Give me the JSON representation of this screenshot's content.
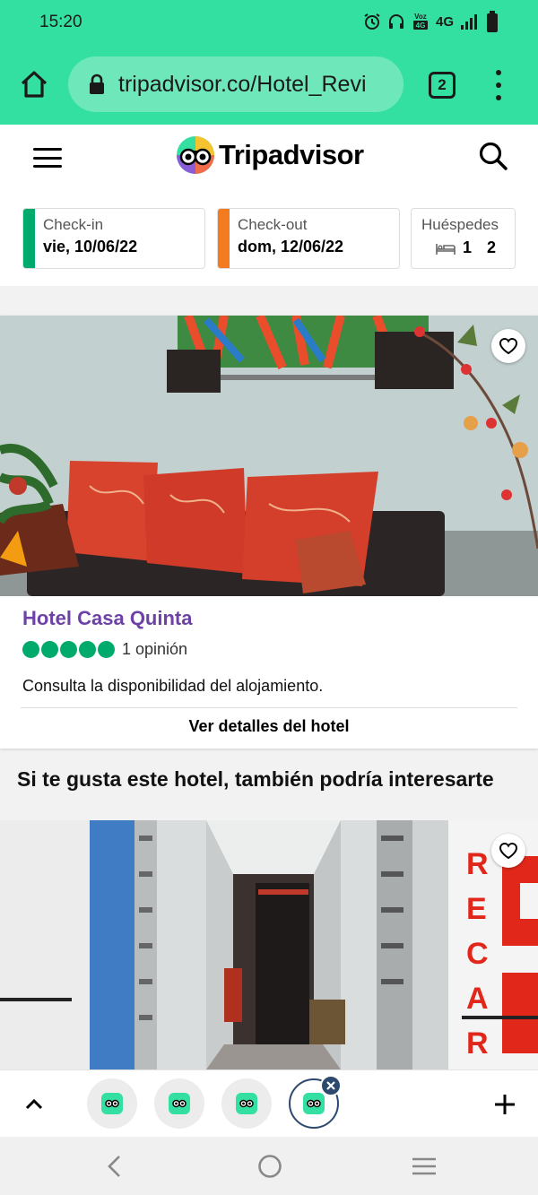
{
  "status_bar": {
    "time": "15:20",
    "indicators": [
      "alarm-icon",
      "headphones-icon",
      "volte-icon",
      "4G",
      "signal-icon",
      "battery-icon"
    ],
    "network": "4G",
    "volte_top": "Voz",
    "volte_bottom": "4G"
  },
  "browser": {
    "url": "tripadvisor.co/Hotel_Revi",
    "tab_count": "2"
  },
  "header": {
    "brand": "Tripadvisor"
  },
  "search": {
    "checkin_label": "Check-in",
    "checkin_value": "vie, 10/06/22",
    "checkout_label": "Check-out",
    "checkout_value": "dom, 12/06/22",
    "guests_label": "Huéspedes",
    "rooms": "1",
    "guests": "2"
  },
  "hotel": {
    "name": "Hotel Casa Quinta",
    "rating": 5,
    "reviews": "1 opinión",
    "availability": "Consulta la disponibilidad del alojamiento.",
    "details_link": "Ver detalles del hotel"
  },
  "recommendations": {
    "title": "Si te gusta este hotel, también podría interesarte",
    "sign_letters": "RECAR"
  },
  "colors": {
    "brand_green": "#34e0a1",
    "checkin_bar": "#00aa6c",
    "checkout_bar": "#f47b20",
    "hotel_name": "#6e41a8",
    "rating_bubble": "#00aa6c"
  }
}
